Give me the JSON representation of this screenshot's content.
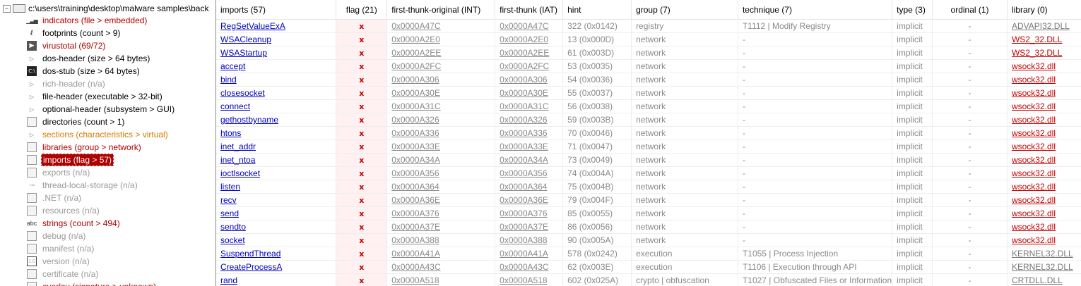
{
  "tree": {
    "root_label": "c:\\users\\training\\desktop\\malware samples\\back",
    "items": [
      {
        "label": "indicators (file > embedded)",
        "icon": "bars",
        "name": "indicators",
        "color": "red"
      },
      {
        "label": "footprints (count > 9)",
        "icon": "footprint",
        "name": "footprints",
        "color": "black"
      },
      {
        "label": "virustotal (69/72)",
        "icon": "vt",
        "name": "virustotal",
        "color": "red"
      },
      {
        "label": "dos-header (size > 64 bytes)",
        "icon": "tri",
        "name": "dos-header",
        "color": "black"
      },
      {
        "label": "dos-stub (size > 64 bytes)",
        "icon": "dark",
        "name": "dos-stub",
        "color": "black"
      },
      {
        "label": "rich-header (n/a)",
        "icon": "tri",
        "name": "rich-header",
        "color": "gray"
      },
      {
        "label": "file-header (executable > 32-bit)",
        "icon": "tri",
        "name": "file-header",
        "color": "black"
      },
      {
        "label": "optional-header (subsystem > GUI)",
        "icon": "tri",
        "name": "optional-header",
        "color": "black"
      },
      {
        "label": "directories (count > 1)",
        "icon": "box",
        "name": "directories",
        "color": "black"
      },
      {
        "label": "sections (characteristics > virtual)",
        "icon": "tri",
        "name": "sections",
        "color": "orange"
      },
      {
        "label": "libraries (group > network)",
        "icon": "box",
        "name": "libraries",
        "color": "red"
      },
      {
        "label": "imports (flag > 57)",
        "icon": "box",
        "name": "imports",
        "color": "red",
        "selected": true
      },
      {
        "label": "exports (n/a)",
        "icon": "boxgray",
        "name": "exports",
        "color": "gray"
      },
      {
        "label": "thread-local-storage (n/a)",
        "icon": "key",
        "name": "thread-local-storage",
        "color": "gray"
      },
      {
        "label": ".NET (n/a)",
        "icon": "boxgray",
        "name": "dotnet",
        "color": "gray"
      },
      {
        "label": "resources (n/a)",
        "icon": "boxgray",
        "name": "resources",
        "color": "gray"
      },
      {
        "label": "strings (count > 494)",
        "icon": "abc",
        "name": "strings",
        "color": "red"
      },
      {
        "label": "debug (n/a)",
        "icon": "boxgray",
        "name": "debug",
        "color": "gray"
      },
      {
        "label": "manifest (n/a)",
        "icon": "boxgray",
        "name": "manifest",
        "color": "gray"
      },
      {
        "label": "version (n/a)",
        "icon": "ver",
        "name": "version",
        "color": "gray"
      },
      {
        "label": "certificate (n/a)",
        "icon": "boxgray",
        "name": "certificate",
        "color": "gray"
      },
      {
        "label": "overlay (signature > unknown)",
        "icon": "boxgray",
        "name": "overlay",
        "color": "red"
      }
    ]
  },
  "table": {
    "headers": {
      "imports": "imports (57)",
      "flag": "flag (21)",
      "int": "first-thunk-original (INT)",
      "iat": "first-thunk (IAT)",
      "hint": "hint",
      "group": "group (7)",
      "technique": "technique (7)",
      "type": "type (3)",
      "ordinal": "ordinal (1)",
      "library": "library (0)"
    },
    "flag_symbol": "x",
    "rows": [
      {
        "name": "RegSetValueExA",
        "int": "0x0000A47C",
        "iat": "0x0000A47C",
        "hint": "322 (0x0142)",
        "group": "registry",
        "technique": "T1112 | Modify Registry",
        "type": "implicit",
        "ordinal": "-",
        "library": "ADVAPI32.DLL",
        "lib_flag": false
      },
      {
        "name": "WSACleanup",
        "int": "0x0000A2E0",
        "iat": "0x0000A2E0",
        "hint": "13 (0x000D)",
        "group": "network",
        "technique": "-",
        "type": "implicit",
        "ordinal": "-",
        "library": "WS2_32.DLL",
        "lib_flag": true
      },
      {
        "name": "WSAStartup",
        "int": "0x0000A2EE",
        "iat": "0x0000A2EE",
        "hint": "61 (0x003D)",
        "group": "network",
        "technique": "-",
        "type": "implicit",
        "ordinal": "-",
        "library": "WS2_32.DLL",
        "lib_flag": true
      },
      {
        "name": "accept",
        "int": "0x0000A2FC",
        "iat": "0x0000A2FC",
        "hint": "53 (0x0035)",
        "group": "network",
        "technique": "-",
        "type": "implicit",
        "ordinal": "-",
        "library": "wsock32.dll",
        "lib_flag": true
      },
      {
        "name": "bind",
        "int": "0x0000A306",
        "iat": "0x0000A306",
        "hint": "54 (0x0036)",
        "group": "network",
        "technique": "-",
        "type": "implicit",
        "ordinal": "-",
        "library": "wsock32.dll",
        "lib_flag": true
      },
      {
        "name": "closesocket",
        "int": "0x0000A30E",
        "iat": "0x0000A30E",
        "hint": "55 (0x0037)",
        "group": "network",
        "technique": "-",
        "type": "implicit",
        "ordinal": "-",
        "library": "wsock32.dll",
        "lib_flag": true
      },
      {
        "name": "connect",
        "int": "0x0000A31C",
        "iat": "0x0000A31C",
        "hint": "56 (0x0038)",
        "group": "network",
        "technique": "-",
        "type": "implicit",
        "ordinal": "-",
        "library": "wsock32.dll",
        "lib_flag": true
      },
      {
        "name": "gethostbyname",
        "int": "0x0000A326",
        "iat": "0x0000A326",
        "hint": "59 (0x003B)",
        "group": "network",
        "technique": "-",
        "type": "implicit",
        "ordinal": "-",
        "library": "wsock32.dll",
        "lib_flag": true
      },
      {
        "name": "htons",
        "int": "0x0000A336",
        "iat": "0x0000A336",
        "hint": "70 (0x0046)",
        "group": "network",
        "technique": "-",
        "type": "implicit",
        "ordinal": "-",
        "library": "wsock32.dll",
        "lib_flag": true
      },
      {
        "name": "inet_addr",
        "int": "0x0000A33E",
        "iat": "0x0000A33E",
        "hint": "71 (0x0047)",
        "group": "network",
        "technique": "-",
        "type": "implicit",
        "ordinal": "-",
        "library": "wsock32.dll",
        "lib_flag": true
      },
      {
        "name": "inet_ntoa",
        "int": "0x0000A34A",
        "iat": "0x0000A34A",
        "hint": "73 (0x0049)",
        "group": "network",
        "technique": "-",
        "type": "implicit",
        "ordinal": "-",
        "library": "wsock32.dll",
        "lib_flag": true
      },
      {
        "name": "ioctlsocket",
        "int": "0x0000A356",
        "iat": "0x0000A356",
        "hint": "74 (0x004A)",
        "group": "network",
        "technique": "-",
        "type": "implicit",
        "ordinal": "-",
        "library": "wsock32.dll",
        "lib_flag": true
      },
      {
        "name": "listen",
        "int": "0x0000A364",
        "iat": "0x0000A364",
        "hint": "75 (0x004B)",
        "group": "network",
        "technique": "-",
        "type": "implicit",
        "ordinal": "-",
        "library": "wsock32.dll",
        "lib_flag": true
      },
      {
        "name": "recv",
        "int": "0x0000A36E",
        "iat": "0x0000A36E",
        "hint": "79 (0x004F)",
        "group": "network",
        "technique": "-",
        "type": "implicit",
        "ordinal": "-",
        "library": "wsock32.dll",
        "lib_flag": true
      },
      {
        "name": "send",
        "int": "0x0000A376",
        "iat": "0x0000A376",
        "hint": "85 (0x0055)",
        "group": "network",
        "technique": "-",
        "type": "implicit",
        "ordinal": "-",
        "library": "wsock32.dll",
        "lib_flag": true
      },
      {
        "name": "sendto",
        "int": "0x0000A37E",
        "iat": "0x0000A37E",
        "hint": "86 (0x0056)",
        "group": "network",
        "technique": "-",
        "type": "implicit",
        "ordinal": "-",
        "library": "wsock32.dll",
        "lib_flag": true
      },
      {
        "name": "socket",
        "int": "0x0000A388",
        "iat": "0x0000A388",
        "hint": "90 (0x005A)",
        "group": "network",
        "technique": "-",
        "type": "implicit",
        "ordinal": "-",
        "library": "wsock32.dll",
        "lib_flag": true
      },
      {
        "name": "SuspendThread",
        "int": "0x0000A41A",
        "iat": "0x0000A41A",
        "hint": "578 (0x0242)",
        "group": "execution",
        "technique": "T1055 | Process Injection",
        "type": "implicit",
        "ordinal": "-",
        "library": "KERNEL32.DLL",
        "lib_flag": false
      },
      {
        "name": "CreateProcessA",
        "int": "0x0000A43C",
        "iat": "0x0000A43C",
        "hint": "62 (0x003E)",
        "group": "execution",
        "technique": "T1106 | Execution through API",
        "type": "implicit",
        "ordinal": "-",
        "library": "KERNEL32.DLL",
        "lib_flag": false
      },
      {
        "name": "rand",
        "int": "0x0000A518",
        "iat": "0x0000A518",
        "hint": "602 (0x025A)",
        "group": "crypto | obfuscation",
        "technique": "T1027 | Obfuscated Files or Information",
        "type": "implicit",
        "ordinal": "-",
        "library": "CRTDLL.DLL",
        "lib_flag": false
      }
    ]
  }
}
